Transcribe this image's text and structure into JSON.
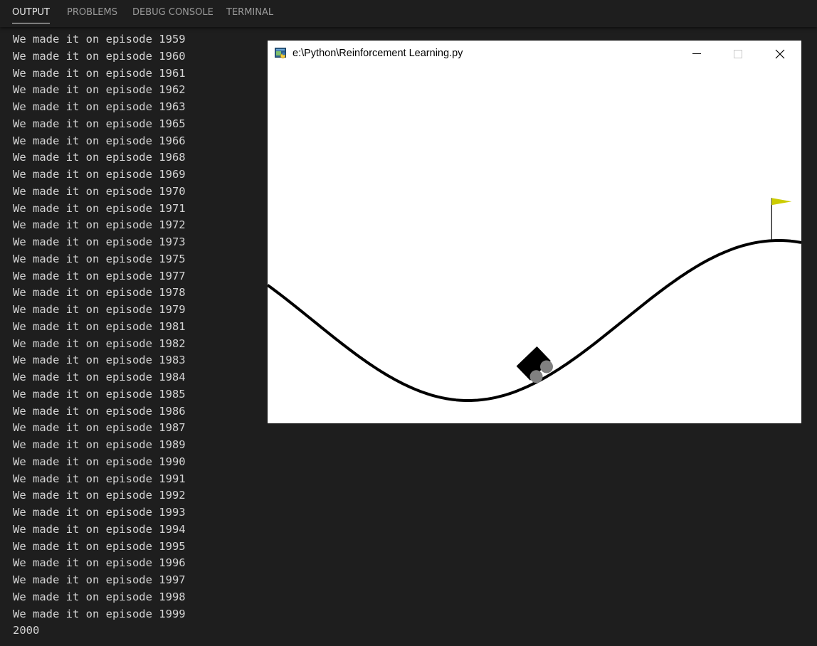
{
  "panel": {
    "tabs": [
      "OUTPUT",
      "PROBLEMS",
      "DEBUG CONSOLE",
      "TERMINAL"
    ],
    "active_tab": "OUTPUT"
  },
  "output": {
    "lines": [
      "We made it on episode 1959",
      "We made it on episode 1960",
      "We made it on episode 1961",
      "We made it on episode 1962",
      "We made it on episode 1963",
      "We made it on episode 1965",
      "We made it on episode 1966",
      "We made it on episode 1968",
      "We made it on episode 1969",
      "We made it on episode 1970",
      "We made it on episode 1971",
      "We made it on episode 1972",
      "We made it on episode 1973",
      "We made it on episode 1975",
      "We made it on episode 1977",
      "We made it on episode 1978",
      "We made it on episode 1979",
      "We made it on episode 1981",
      "We made it on episode 1982",
      "We made it on episode 1983",
      "We made it on episode 1984",
      "We made it on episode 1985",
      "We made it on episode 1986",
      "We made it on episode 1987",
      "We made it on episode 1989",
      "We made it on episode 1990",
      "We made it on episode 1991",
      "We made it on episode 1992",
      "We made it on episode 1993",
      "We made it on episode 1994",
      "We made it on episode 1995",
      "We made it on episode 1996",
      "We made it on episode 1997",
      "We made it on episode 1998",
      "We made it on episode 1999",
      "2000"
    ]
  },
  "gym_window": {
    "title": "e:\\Python\\Reinforcement Learning.py",
    "icon": "python-file-icon",
    "controls": [
      "minimize-icon",
      "maximize-icon",
      "close-icon"
    ],
    "env": {
      "car_position": -0.26,
      "goal_position": 0.5,
      "flag_color": "#cccc00",
      "track_color": "#000000",
      "wheel_color": "#808080"
    }
  },
  "theme": {
    "background": "#1e1e1e",
    "text": "#d4d4d4",
    "tab_inactive": "#9a9a9a",
    "tab_active": "#e7e7e7"
  }
}
